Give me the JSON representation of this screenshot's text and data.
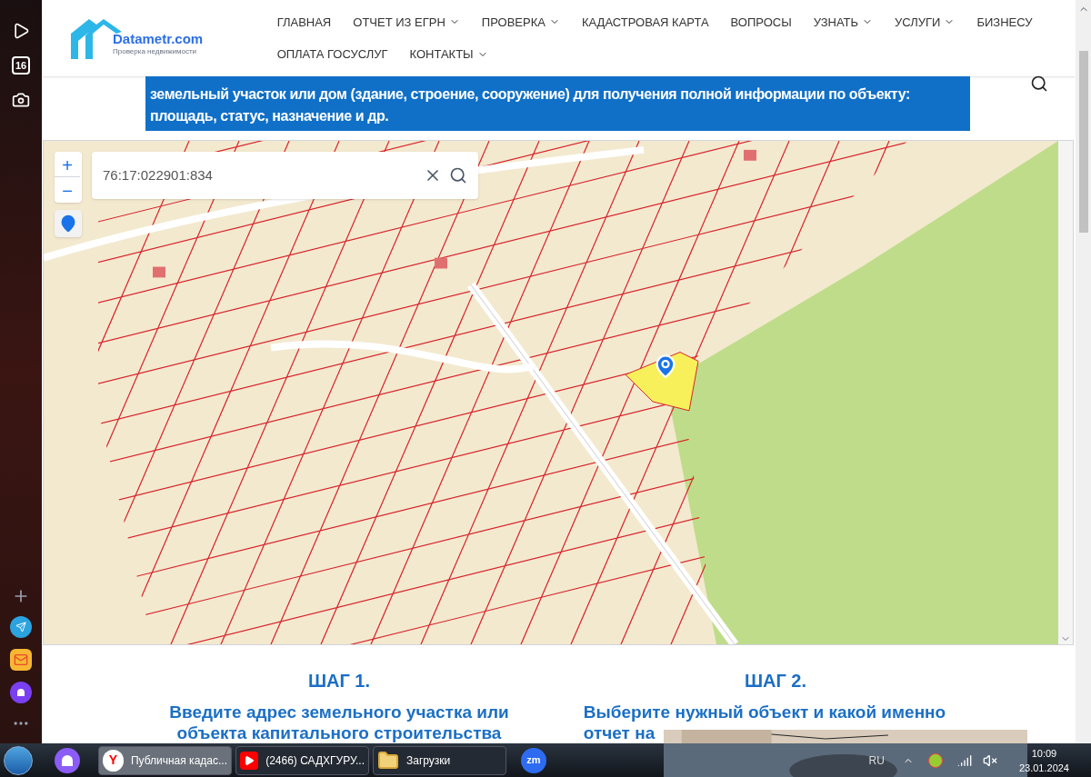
{
  "side_panel": {
    "top_icons": [
      {
        "kind": "play"
      },
      {
        "kind": "calendar"
      },
      {
        "kind": "camera"
      }
    ],
    "calendar_day": "16",
    "bottom_icons": [
      {
        "kind": "add"
      },
      {
        "kind": "telegram"
      },
      {
        "kind": "mail"
      },
      {
        "kind": "alice"
      },
      {
        "kind": "more"
      }
    ]
  },
  "logo": {
    "name": "Datametr.com",
    "tagline": "Проверка недвижимости"
  },
  "nav": [
    {
      "label": "ГЛАВНАЯ",
      "dropdown": false
    },
    {
      "label": "ОТЧЕТ ИЗ ЕГРН",
      "dropdown": true
    },
    {
      "label": "ПРОВЕРКА",
      "dropdown": true
    },
    {
      "label": "КАДАСТРОВАЯ КАРТА",
      "dropdown": false
    },
    {
      "label": "ВОПРОСЫ",
      "dropdown": false
    },
    {
      "label": "УЗНАТЬ",
      "dropdown": true
    },
    {
      "label": "УСЛУГИ",
      "dropdown": true
    },
    {
      "label": "БИЗНЕСУ",
      "dropdown": false
    },
    {
      "label": "ОПЛАТА ГОСУСЛУГ",
      "dropdown": false
    },
    {
      "label": "КОНТАКТЫ",
      "dropdown": true
    }
  ],
  "banner": {
    "lines": [
      "земельный участок или дом (здание, строение, сооружение) для получения полной информации по объекту:",
      "площадь, статус, назначение и др."
    ]
  },
  "map": {
    "search": {
      "value": "76:17:022901:834"
    },
    "zoom_in": "+",
    "zoom_out": "−"
  },
  "steps": [
    {
      "title": "ШАГ 1.",
      "text_lines": [
        "Введите адрес земельного участка или",
        "объекта капитального строительства"
      ],
      "cut": false
    },
    {
      "title": "ШАГ 2.",
      "text_lines": [
        "Выберите нужный объект и какой именно",
        "отчет на"
      ],
      "cut": true
    }
  ],
  "taskbar": {
    "items": [
      {
        "label": "Публичная кадас...",
        "kind": "yandex",
        "icon_text": "Y",
        "selected": true
      },
      {
        "label": "(2466) САДХГУРУ...",
        "kind": "youtube",
        "selected": false
      },
      {
        "label": "Загрузки",
        "kind": "folder",
        "selected": false
      }
    ],
    "meeting_app": "zm",
    "language": "RU",
    "time": "10:09",
    "date": "23.01.2024"
  }
}
